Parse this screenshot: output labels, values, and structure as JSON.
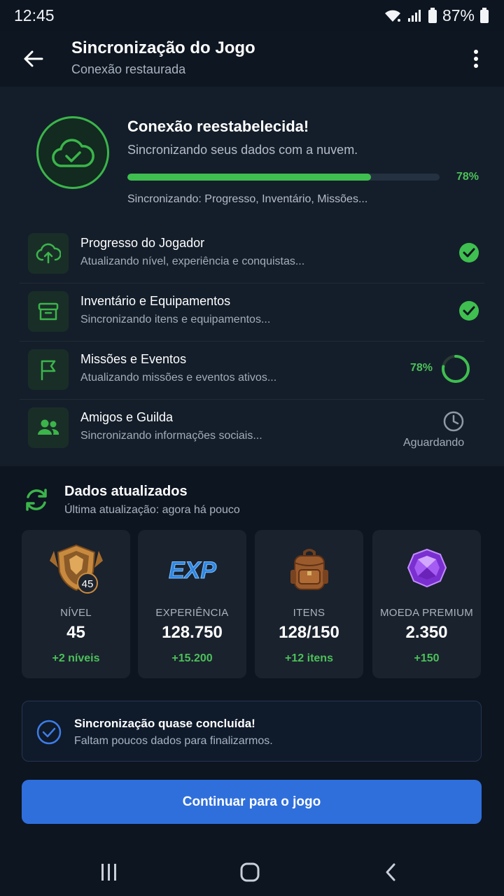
{
  "status_bar": {
    "time": "12:45",
    "battery": "87%"
  },
  "app_bar": {
    "title": "Sincronização do Jogo",
    "subtitle": "Conexão restaurada"
  },
  "connection": {
    "title": "Conexão reestabelecida!",
    "subtitle": "Sincronizando seus dados com a nuvem.",
    "progress": 0.78,
    "progress_label": "78%",
    "syncing_text": "Sincronizando: Progresso, Inventário, Missões..."
  },
  "sync_items": [
    {
      "title": "Progresso do Jogador",
      "subtitle": "Atualizando nível, experiência e conquistas...",
      "status": "done",
      "icon": "cloud-upload-icon"
    },
    {
      "title": "Inventário e Equipamentos",
      "subtitle": "Sincronizando itens e equipamentos...",
      "status": "done",
      "icon": "archive-box-icon"
    },
    {
      "title": "Missões e Eventos",
      "subtitle": "Atualizando missões e eventos ativos...",
      "status": "in_progress",
      "progress": 0.78,
      "progress_label": "78%",
      "icon": "flag-icon"
    },
    {
      "title": "Amigos e Guilda",
      "subtitle": "Sincronizando informações sociais...",
      "status": "waiting",
      "status_label": "Aguardando",
      "icon": "users-icon"
    }
  ],
  "updated": {
    "title": "Dados atualizados",
    "subtitle": "Última atualização: agora há pouco"
  },
  "stats": [
    {
      "label": "NÍVEL",
      "value": "45",
      "delta": "+2 níveis",
      "icon": "level-shield-icon",
      "badge": "45"
    },
    {
      "label": "EXPERIÊNCIA",
      "value": "128.750",
      "delta": "+15.200",
      "icon": "exp-icon",
      "badge": "EXP"
    },
    {
      "label": "ITENS",
      "value": "128/150",
      "delta": "+12 itens",
      "icon": "backpack-icon"
    },
    {
      "label": "MOEDA PREMIUM",
      "value": "2.350",
      "delta": "+150",
      "icon": "gem-icon"
    }
  ],
  "notice": {
    "title": "Sincronização quase concluída!",
    "subtitle": "Faltam poucos dados para finalizarmos."
  },
  "continue_button": "Continuar para o jogo",
  "colors": {
    "accent_green": "#3fbf4f",
    "primary_blue": "#2f6fdc",
    "background": "#0d1520"
  }
}
